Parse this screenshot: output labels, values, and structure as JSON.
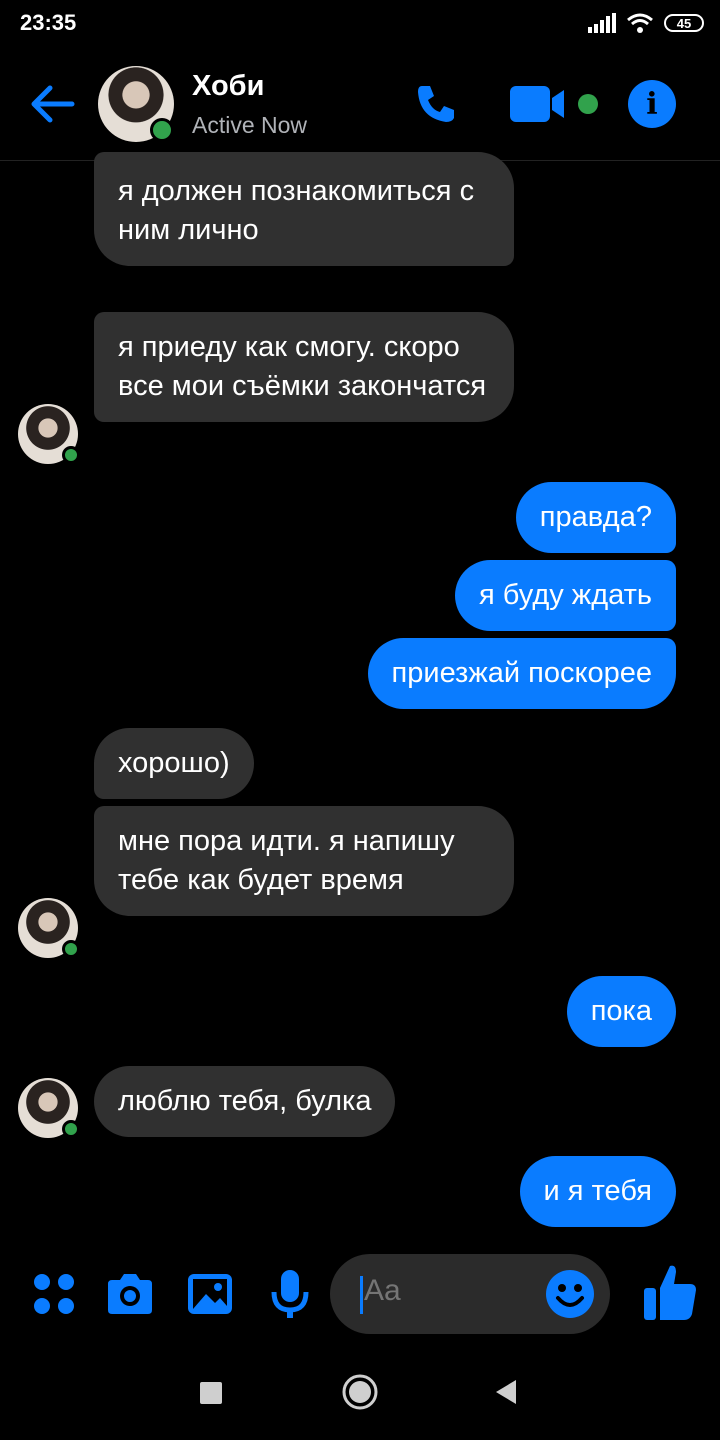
{
  "status_bar": {
    "time": "23:35",
    "battery": "45"
  },
  "header": {
    "contact_name": "Хоби",
    "contact_status": "Active Now"
  },
  "messages": [
    {
      "from": "them",
      "text": "я должен познакомиться с ним лично"
    },
    {
      "from": "them",
      "text": "я приеду как смогу. скоро все мои съёмки закончатся"
    },
    {
      "from": "me",
      "text": "правда?"
    },
    {
      "from": "me",
      "text": "я буду ждать"
    },
    {
      "from": "me",
      "text": "приезжай поскорее"
    },
    {
      "from": "them",
      "text": "хорошо)"
    },
    {
      "from": "them",
      "text": "мне пора идти. я напишу тебе как будет время"
    },
    {
      "from": "me",
      "text": "пока"
    },
    {
      "from": "them",
      "text": "люблю тебя, булка"
    },
    {
      "from": "me",
      "text": "и я тебя"
    }
  ],
  "composer": {
    "placeholder": "Aa"
  },
  "colors": {
    "accent": "#0a7cff",
    "incoming_bubble": "#303030",
    "online": "#31a24c"
  }
}
